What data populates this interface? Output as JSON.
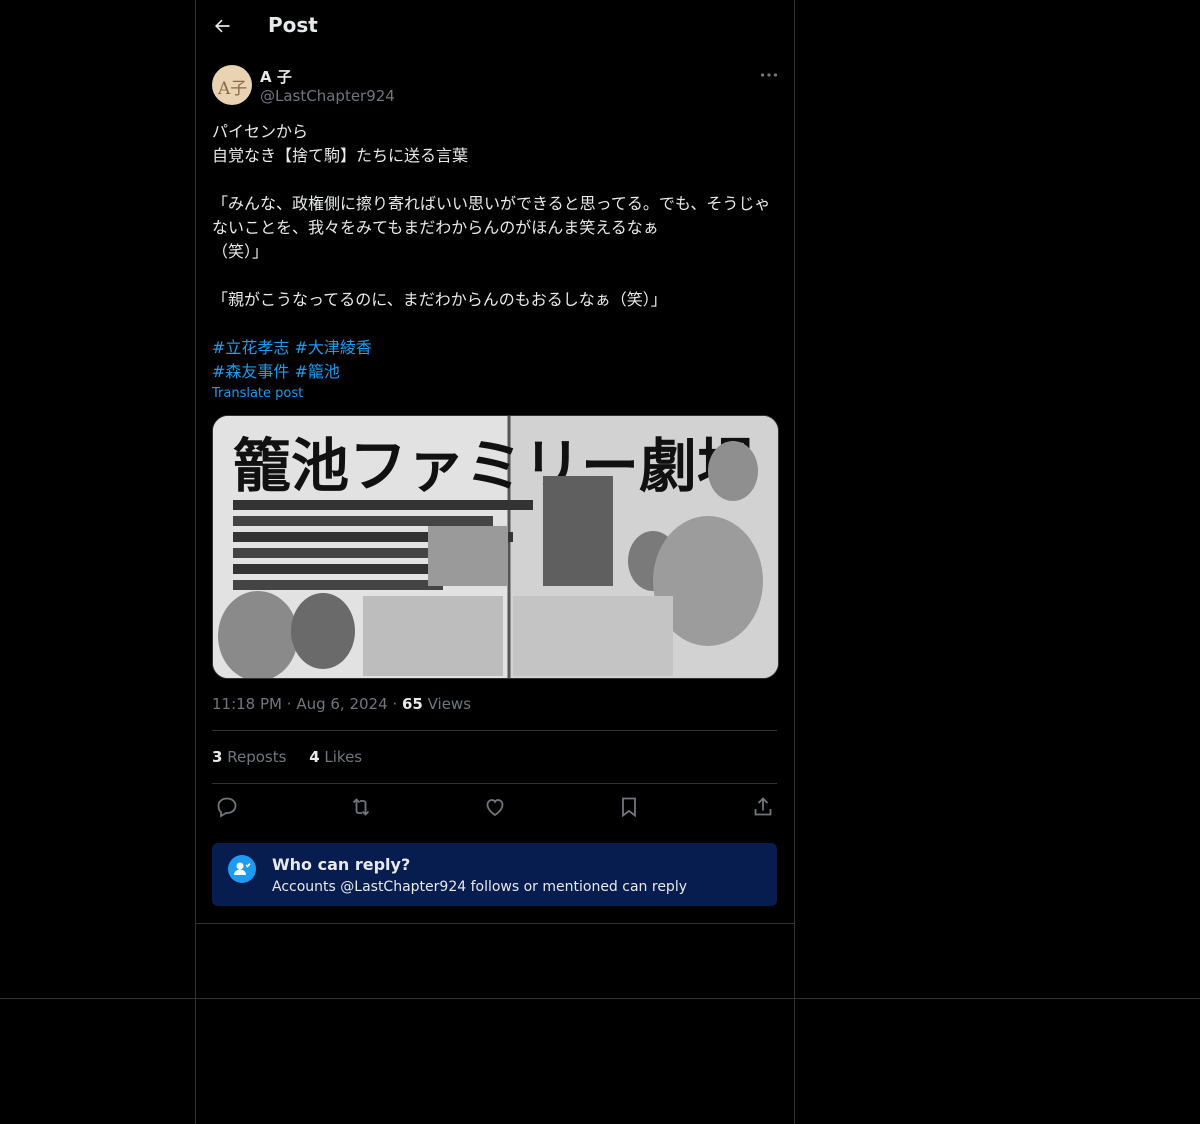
{
  "header": {
    "title": "Post",
    "back_icon": "arrow-left-icon"
  },
  "author": {
    "display_name": "A 子",
    "handle": "@LastChapter924",
    "avatar_text": "A子"
  },
  "post": {
    "text": "パイセンから\n自覚なき【捨て駒】たちに送る言葉\n\n「みんな、政権側に擦り寄ればいい思いができると思ってる。でも、そうじゃないことを、我々をみてもまだわからんのがほんま笑えるなぁ\n（笑）」\n\n「親がこうなってるのに、まだわからんのもおるしなぁ（笑）」",
    "hashtags_line1": [
      "#立花孝志",
      "#大津綾香"
    ],
    "hashtags_line2": [
      "#森友事件",
      "#籠池"
    ],
    "translate_label": "Translate post",
    "media_headline": "籠池ファミリー劇場",
    "time": "11:18 PM",
    "date": "Aug 6, 2024",
    "views_count": "65",
    "views_label": "Views"
  },
  "stats": {
    "reposts_count": "3",
    "reposts_label": "Reposts",
    "likes_count": "4",
    "likes_label": "Likes"
  },
  "actions": [
    "reply-icon",
    "repost-icon",
    "like-icon",
    "bookmark-icon",
    "share-icon"
  ],
  "reply_restriction": {
    "title": "Who can reply?",
    "subtitle": "Accounts @LastChapter924 follows or mentioned can reply"
  },
  "colors": {
    "accent": "#1d9bf0",
    "reply_box_bg": "#071d50"
  }
}
